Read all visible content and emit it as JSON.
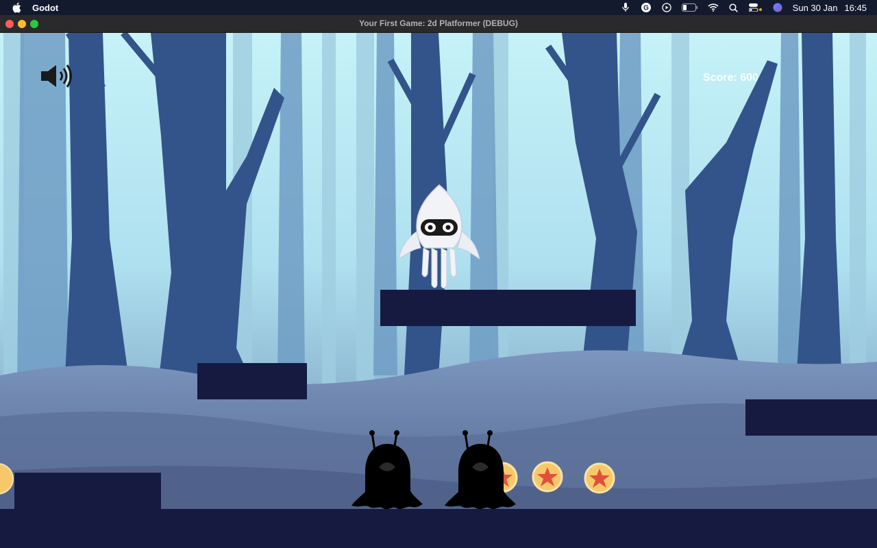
{
  "menubar": {
    "app_name": "Godot",
    "date": "Sun 30 Jan",
    "time": "16:45",
    "icons": [
      "apple-icon",
      "microphone-icon",
      "grammarly-icon",
      "play-icon",
      "battery-icon",
      "wifi-icon",
      "search-icon",
      "control-center-icon",
      "siri-icon"
    ]
  },
  "window": {
    "title": "Your First Game: 2d Platformer (DEBUG)"
  },
  "hud": {
    "score_label": "Score: 600",
    "sound_icon": "speaker-on-icon"
  },
  "colors": {
    "platform": "#161a40",
    "coin": "#f7c86a",
    "star": "#e0503a",
    "sky": "#bfe9f5",
    "trees": "#2e4a7c"
  }
}
